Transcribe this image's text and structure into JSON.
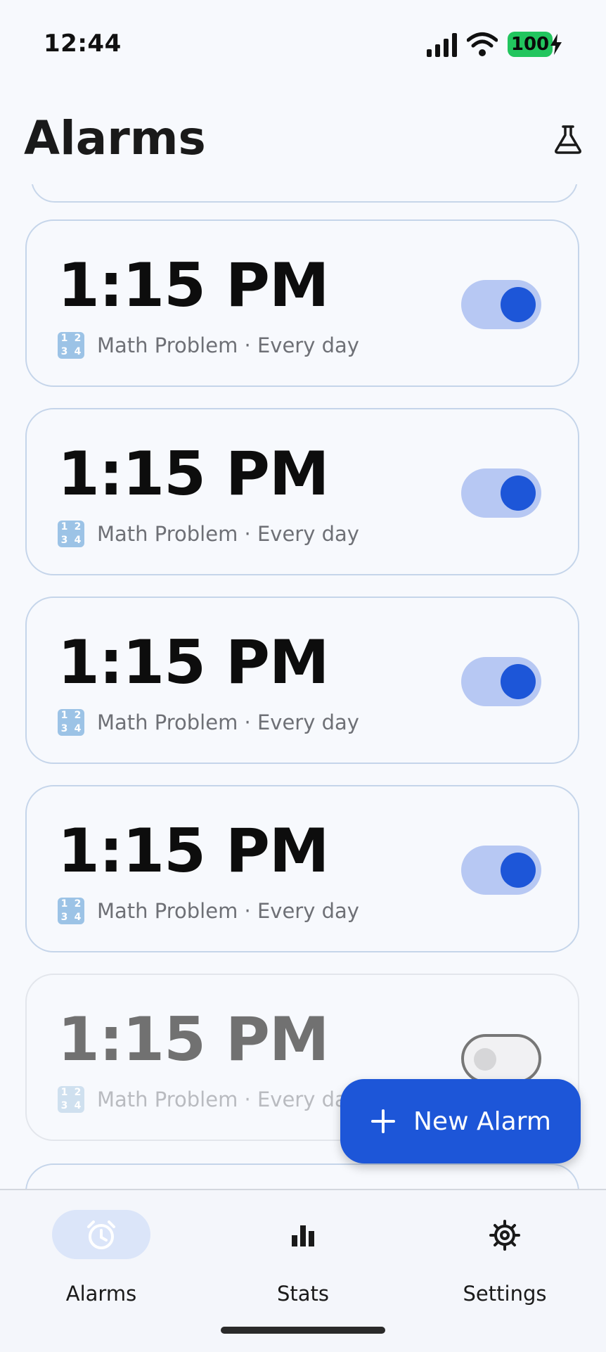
{
  "status_bar": {
    "time": "12:44",
    "battery": "100"
  },
  "header": {
    "title": "Alarms",
    "lab_icon": "flask-icon"
  },
  "alarms": [
    {
      "time": "1:15 PM",
      "subtitle": "Math Problem · Every day",
      "enabled": true
    },
    {
      "time": "1:15 PM",
      "subtitle": "Math Problem · Every day",
      "enabled": true
    },
    {
      "time": "1:15 PM",
      "subtitle": "Math Problem · Every day",
      "enabled": true
    },
    {
      "time": "1:15 PM",
      "subtitle": "Math Problem · Every day",
      "enabled": true
    },
    {
      "time": "1:15 PM",
      "subtitle": "Math Problem · Every day",
      "enabled": false
    }
  ],
  "icons": {
    "numbers": "numbers-icon",
    "plus": "plus-icon",
    "alarm": "alarm-clock-icon",
    "stats": "bar-chart-icon",
    "settings": "gear-icon"
  },
  "fab": {
    "label": "New Alarm"
  },
  "nav": [
    {
      "label": "Alarms",
      "active": true
    },
    {
      "label": "Stats",
      "active": false
    },
    {
      "label": "Settings",
      "active": false
    }
  ],
  "colors": {
    "accent": "#1d56d8",
    "toggle_track_on": "#b7c8f3",
    "nav_active_pill": "#dbe5f9",
    "battery": "#22c55e"
  }
}
